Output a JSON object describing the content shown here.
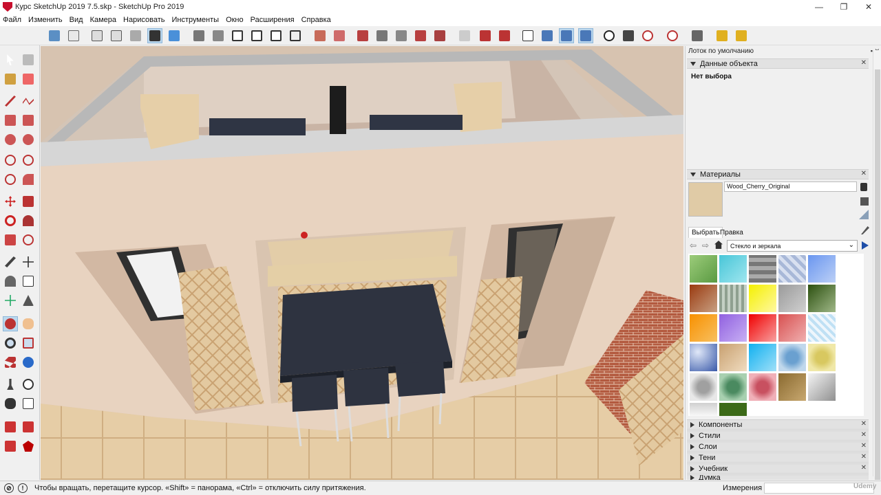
{
  "titlebar": {
    "title": "Курс SketchUp 2019 7.5.skp - SketchUp Pro 2019",
    "minimize": "—",
    "maximize": "❐",
    "close": "✕"
  },
  "menubar": {
    "items": [
      "Файл",
      "Изменить",
      "Вид",
      "Камера",
      "Нарисовать",
      "Инструменты",
      "Окно",
      "Расширения",
      "Справка"
    ]
  },
  "tray": {
    "title": "Лоток по умолчанию",
    "pin": "▪ ✕",
    "entity_info": {
      "header": "Данные объекта",
      "status": "Нет выбора"
    },
    "materials": {
      "header": "Материалы",
      "material_name": "Wood_Cherry_Original",
      "tab_select": "Выбрать",
      "tab_edit": "Правка",
      "library": "Стекло и зеркала",
      "dropdown_arrow": "⌄"
    },
    "collapsed_panels": [
      "Компоненты",
      "Стили",
      "Слои",
      "Тени",
      "Учебник",
      "Думка"
    ]
  },
  "statusbar": {
    "hint": "Чтобы вращать, перетащите курсор. «Shift» = панорама, «Ctrl» = отключить силу притяжения.",
    "measurements_label": "Измерения",
    "measurements_value": "",
    "watermark": "Udemy"
  },
  "toolbar_icons": [
    "select-icon",
    "eraser-icon",
    "line-icon",
    "arc-icon",
    "rectangle-icon",
    "circle-icon",
    "push-pull-icon",
    "move-icon",
    "rotate-icon",
    "scale-icon",
    "offset-icon",
    "tape-measure-icon",
    "text-icon",
    "axes-icon",
    "dimension-icon",
    "protractor-icon",
    "orbit-icon",
    "pan-icon",
    "zoom-icon",
    "zoom-extents-icon",
    "walk-icon",
    "look-around-icon",
    "section-plane-icon",
    "follow-me-icon",
    "paint-bucket-icon",
    "components-icon"
  ],
  "colors": {
    "accent": "#bcd8ee",
    "wall": "#e8d3c0",
    "floor": "#e6cda6",
    "table_top": "#2e3340",
    "brick": "#b35a3f"
  }
}
